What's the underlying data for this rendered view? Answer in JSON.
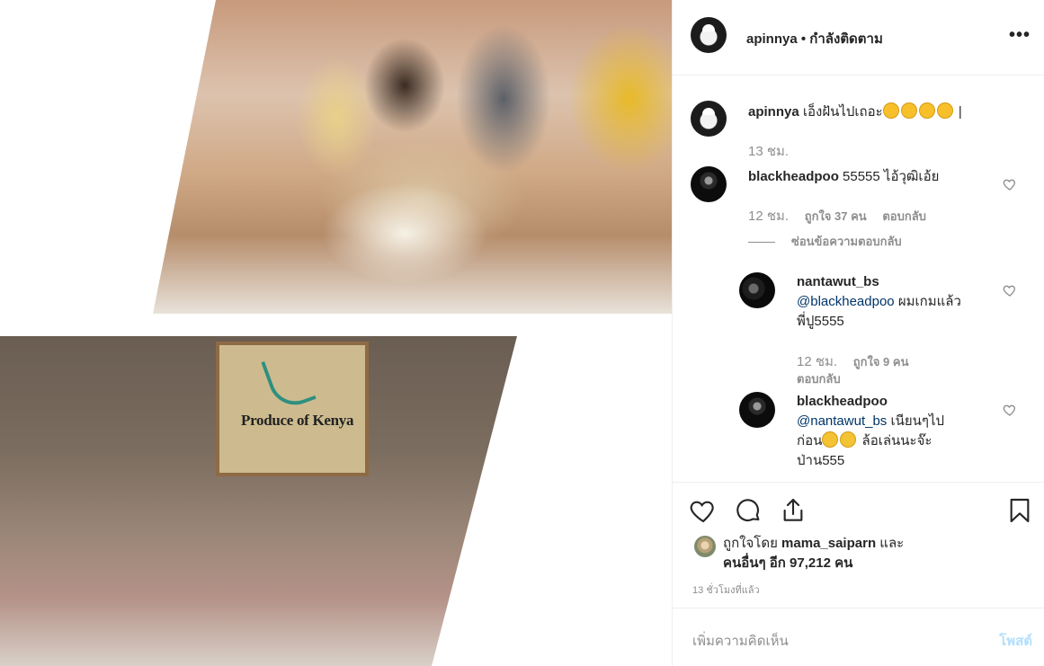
{
  "media": {
    "map_text": "Produce of Kenya"
  },
  "header": {
    "username": "apinnya",
    "separator": "•",
    "follow_state": "กำลังติดตาม",
    "more_label": "•••"
  },
  "caption": {
    "username": "apinnya",
    "text": "เอ็งฝันไปเถอะ",
    "emoji_count": 4,
    "trailing": "|",
    "time": "13 ชม."
  },
  "comments": [
    {
      "username": "blackheadpoo",
      "text": "55555 ไอ้วุฒิเอ้ย",
      "time": "12 ชม.",
      "likes": "ถูกใจ 37 คน",
      "reply_label": "ตอบกลับ",
      "hide_replies_label": "ซ่อนข้อความตอบกลับ"
    }
  ],
  "replies": [
    {
      "username": "nantawut_bs",
      "mention": "@blackheadpoo",
      "text_line1": "ผมเกมแล้ว",
      "text_line2": "พี่ปู5555",
      "time": "12 ชม.",
      "likes": "ถูกใจ 9 คน",
      "reply_label": "ตอบกลับ"
    },
    {
      "username": "blackheadpoo",
      "mention": "@nantawut_bs",
      "text_line1": "เนียนๆไป",
      "text_line2_prefix": "ก่อน",
      "text_line2_suffix": "ล้อเล่นนะจ๊ะ",
      "text_line3": "ป่าน555"
    }
  ],
  "likes": {
    "prefix": "ถูกใจโดย",
    "liker": "mama_saiparn",
    "and": "และ",
    "others": "คนอื่นๆ อีก 97,212 คน"
  },
  "time_ago": "13 ชั่วโมงที่แล้ว",
  "add_comment": {
    "placeholder": "เพิ่มความคิดเห็น",
    "post_label": "โพสต์"
  },
  "colors": {
    "text": "#262626",
    "muted": "#8e8e8e",
    "mention": "#003569",
    "post_disabled": "#b2dffc",
    "border": "#efefef"
  },
  "icons": [
    "heart-icon",
    "comment-icon",
    "share-icon",
    "bookmark-icon",
    "more-icon"
  ]
}
